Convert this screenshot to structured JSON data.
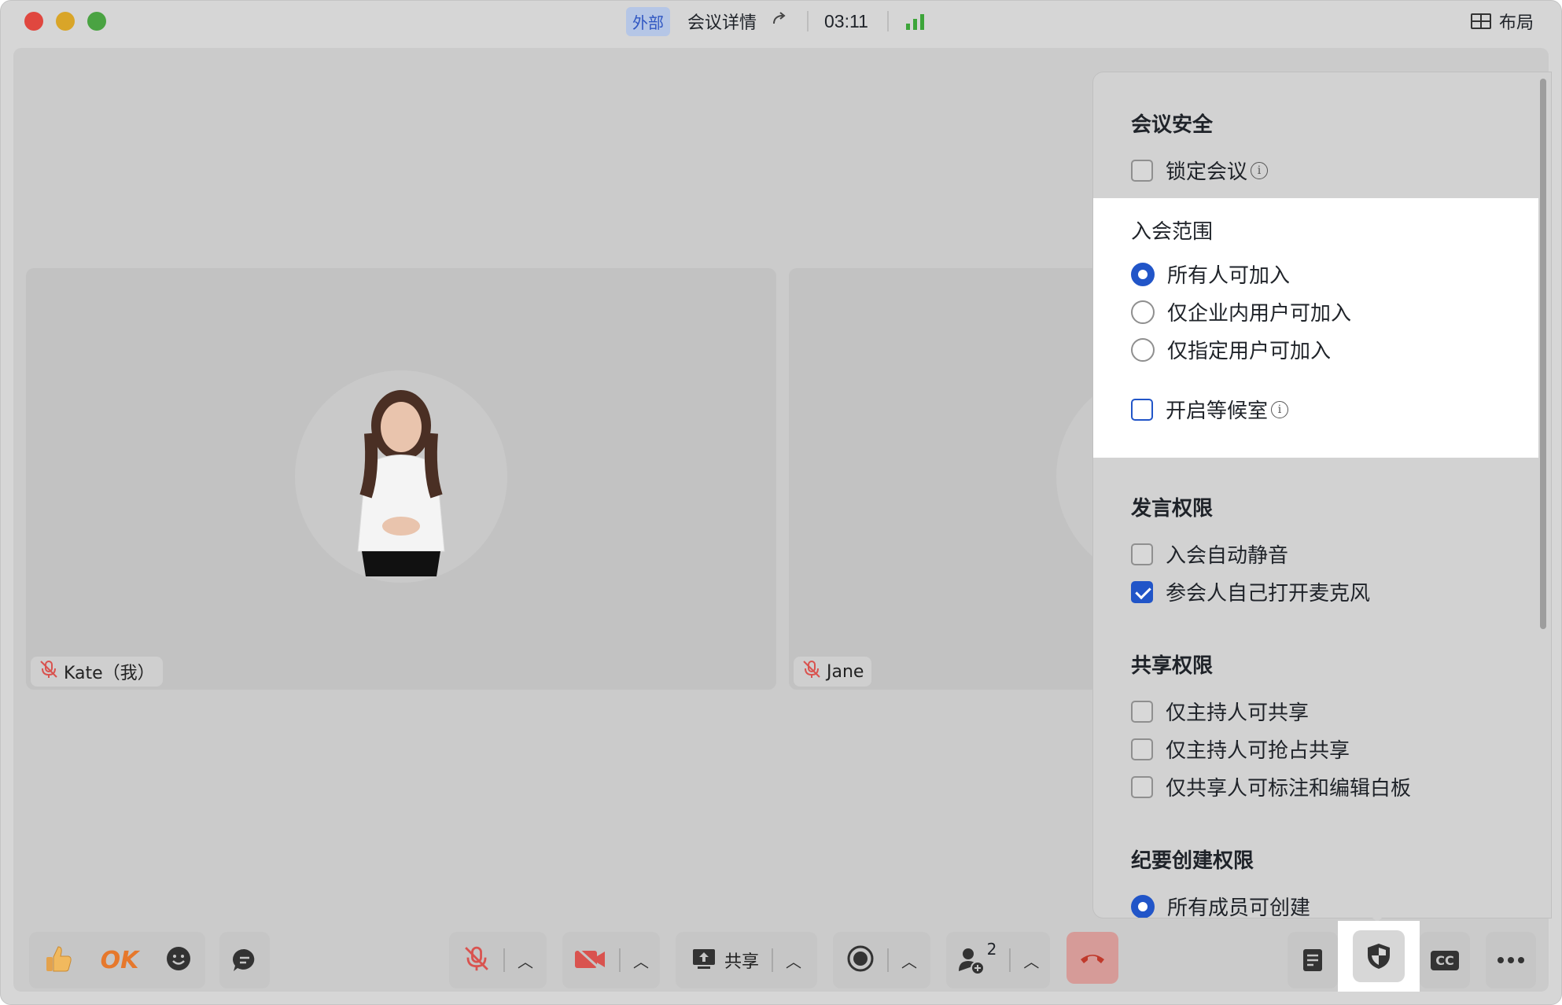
{
  "titlebar": {
    "external_tag": "外部",
    "meeting_details": "会议详情",
    "timer": "03:11",
    "layout_label": "布局"
  },
  "participants": [
    {
      "name": "Kate（我）",
      "muted": true
    },
    {
      "name": "Jane",
      "muted": true
    }
  ],
  "security_panel": {
    "meeting_security": {
      "title": "会议安全",
      "lock_meeting": {
        "label": "锁定会议",
        "checked": false
      }
    },
    "join_scope": {
      "title": "入会范围",
      "options": [
        {
          "label": "所有人可加入",
          "selected": true
        },
        {
          "label": "仅企业内用户可加入",
          "selected": false
        },
        {
          "label": "仅指定用户可加入",
          "selected": false
        }
      ],
      "waiting_room": {
        "label": "开启等候室",
        "checked": true
      }
    },
    "speak_permission": {
      "title": "发言权限",
      "options": [
        {
          "label": "入会自动静音",
          "checked": false
        },
        {
          "label": "参会人自己打开麦克风",
          "checked": true
        }
      ]
    },
    "share_permission": {
      "title": "共享权限",
      "options": [
        {
          "label": "仅主持人可共享",
          "checked": false
        },
        {
          "label": "仅主持人可抢占共享",
          "checked": false
        },
        {
          "label": "仅共享人可标注和编辑白板",
          "checked": false
        }
      ]
    },
    "minutes_permission": {
      "title": "纪要创建权限",
      "options": [
        {
          "label": "所有成员可创建",
          "selected": true
        }
      ]
    }
  },
  "toolbar": {
    "reaction_ok": "OK",
    "share_label": "共享",
    "participants_count": "2",
    "cc_label": "CC"
  },
  "colors": {
    "accent": "#2155c8",
    "signal": "#3da53a",
    "end_call": "#d69b98",
    "muted_icon": "#d9534f"
  }
}
